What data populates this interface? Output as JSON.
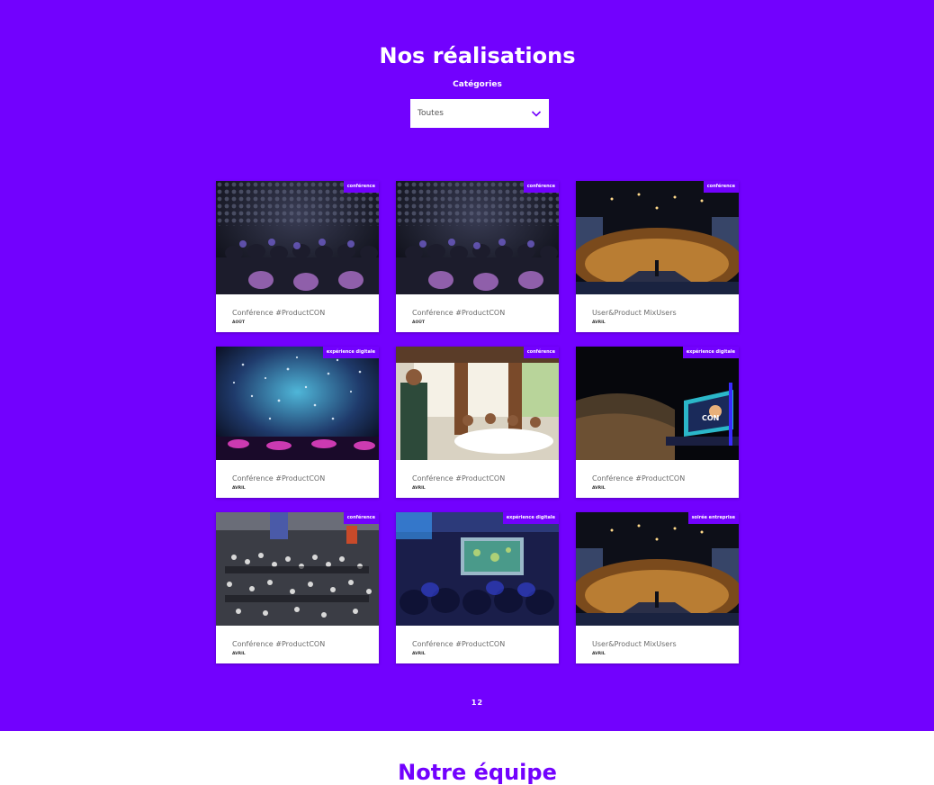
{
  "section": {
    "title": "Nos réalisations",
    "filter_label": "Catégories",
    "filter_value": "Toutes"
  },
  "cards": [
    {
      "tag": "conférence",
      "title": "Conférence #ProductCON",
      "month": "AOÛT",
      "image": "audience-dark"
    },
    {
      "tag": "conférence",
      "title": "Conférence #ProductCON",
      "month": "AOÛT",
      "image": "audience-dark"
    },
    {
      "tag": "conférence",
      "title": "User&Product MixUsers",
      "month": "AVRIL",
      "image": "auditorium"
    },
    {
      "tag": "expérience digitale",
      "title": "Conférence #ProductCON",
      "month": "AVRIL",
      "image": "confetti"
    },
    {
      "tag": "conférence",
      "title": "Conférence #ProductCON",
      "month": "AVRIL",
      "image": "dinner"
    },
    {
      "tag": "expérience digitale",
      "title": "Conférence #ProductCON",
      "month": "AVRIL",
      "image": "stage-screen"
    },
    {
      "tag": "conférence",
      "title": "Conférence #ProductCON",
      "month": "AVRIL",
      "image": "crowd"
    },
    {
      "tag": "expérience digitale",
      "title": "Conférence #ProductCON",
      "month": "AVRIL",
      "image": "projection-room"
    },
    {
      "tag": "soirée entreprise",
      "title": "User&Product MixUsers",
      "month": "AVRIL",
      "image": "auditorium"
    }
  ],
  "pagination": {
    "page1": "1",
    "page2": "2"
  },
  "team": {
    "title": "Notre équipe"
  },
  "colors": {
    "brand": "#7201fe",
    "card_bg": "#ffffff"
  }
}
